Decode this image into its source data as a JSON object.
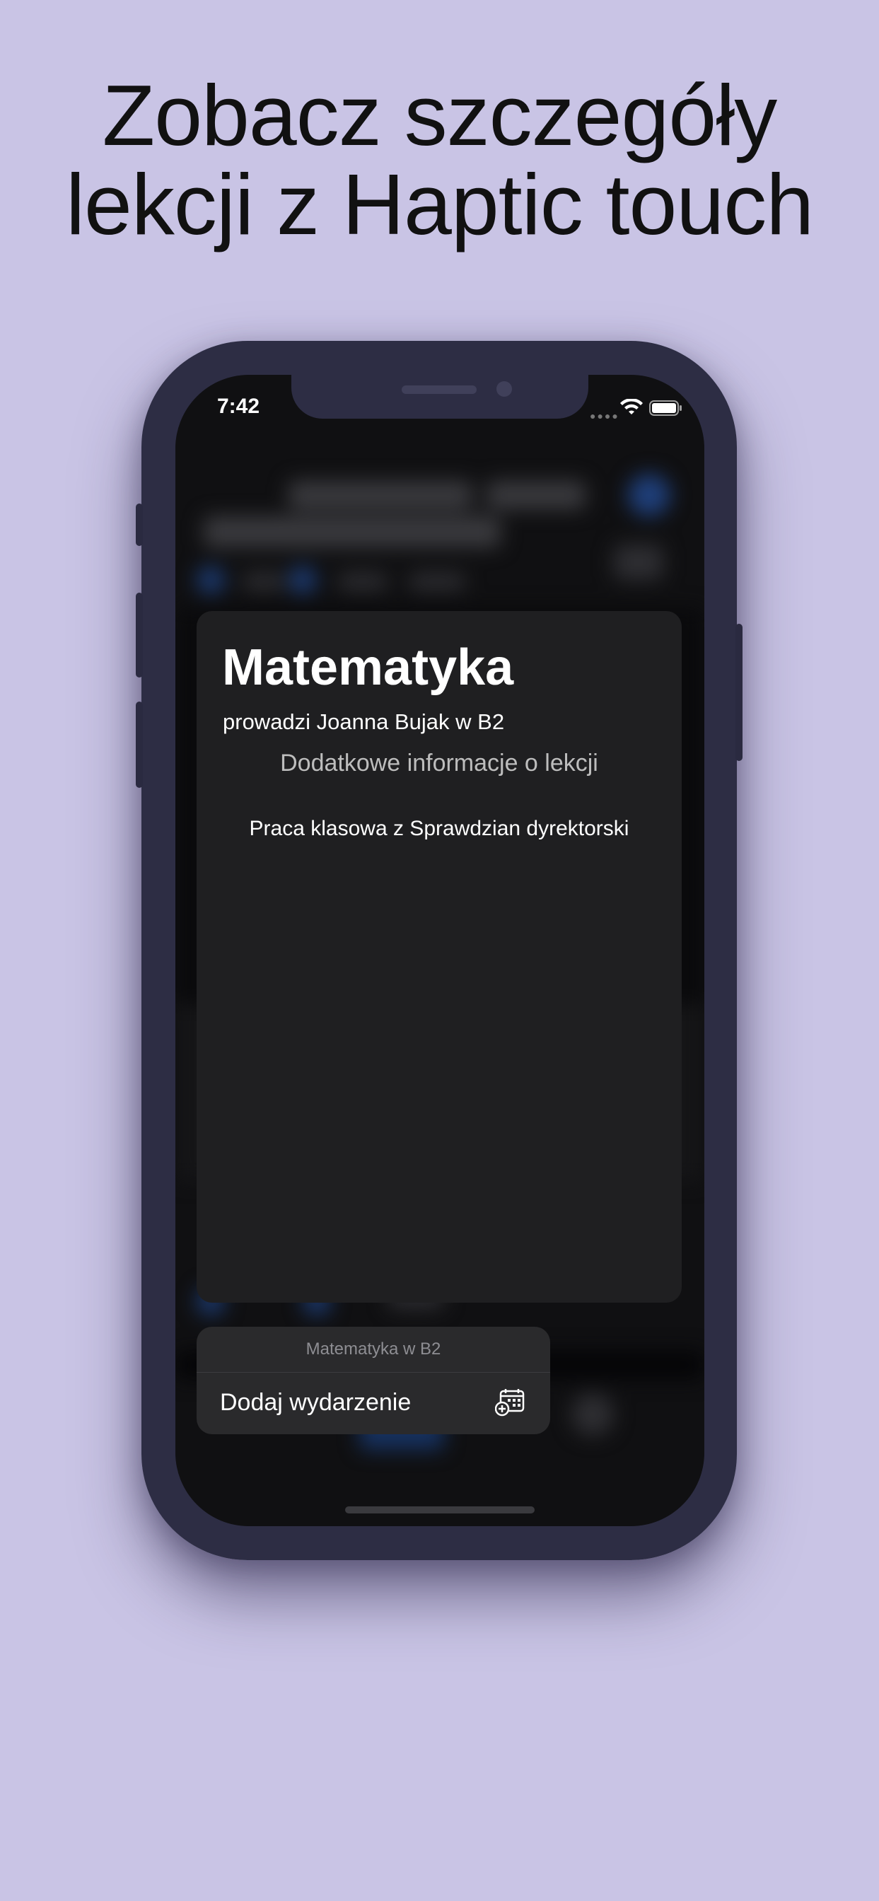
{
  "headline": {
    "line1": "Zobacz szczegóły",
    "line2": "lekcji z Haptic touch"
  },
  "status_bar": {
    "time": "7:42",
    "signal_icon": "signal-dots-icon",
    "wifi_icon": "wifi-icon",
    "battery_icon": "battery-icon"
  },
  "lesson_card": {
    "title": "Matematyka",
    "subtitle": "prowadzi Joanna Bujak w B2",
    "section_header": "Dodatkowe informacje o lekcji",
    "items": [
      "Praca klasowa z Sprawdzian dyrektorski"
    ]
  },
  "action_menu": {
    "header": "Matematyka w B2",
    "items": [
      {
        "label": "Dodaj wydarzenie",
        "icon": "calendar-add-icon"
      }
    ]
  },
  "colors": {
    "background": "#c9c4e5",
    "phone_frame": "#2d2d44",
    "card_background": "#1f1f21",
    "menu_background": "#2a2a2c"
  }
}
